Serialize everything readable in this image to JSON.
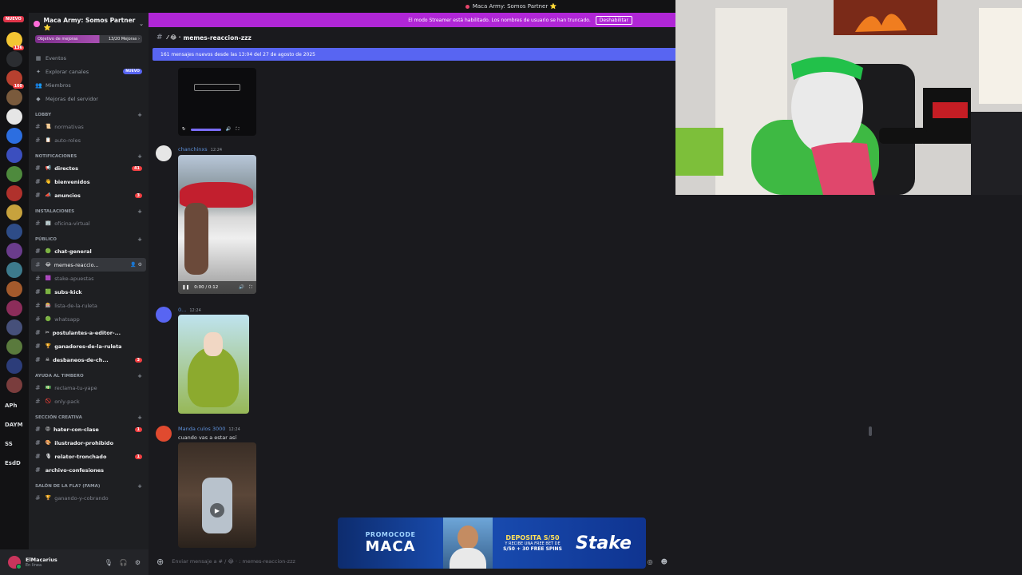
{
  "window": {
    "title": "Maca Army: Somos Partner ⭐"
  },
  "rail": {
    "new_label": "NUEVO",
    "servers": [
      {
        "color": "#f3c533",
        "badge": "136"
      },
      {
        "color": "#2b2d31",
        "badge": ""
      },
      {
        "color": "#b8402f",
        "badge": "160"
      },
      {
        "color": "#7a5a3c",
        "badge": ""
      },
      {
        "color": "#e6e6e6",
        "badge": ""
      },
      {
        "color": "#2c6ee0",
        "badge": ""
      },
      {
        "color": "#3b4fbf",
        "badge": ""
      },
      {
        "color": "#4e8a3d",
        "badge": ""
      },
      {
        "color": "#b0312c",
        "badge": ""
      },
      {
        "color": "#c7a23d",
        "badge": ""
      },
      {
        "color": "#2e4c87",
        "badge": ""
      },
      {
        "color": "#6a3c8c",
        "badge": ""
      },
      {
        "color": "#3d7a8c",
        "badge": ""
      },
      {
        "color": "#a35a2c",
        "badge": ""
      },
      {
        "color": "#8c2d5a",
        "badge": ""
      },
      {
        "color": "#46507a",
        "badge": ""
      },
      {
        "color": "#5a7a3d",
        "badge": ""
      },
      {
        "color": "#2c3d7a",
        "badge": ""
      },
      {
        "color": "#7a3d3d",
        "badge": ""
      }
    ],
    "labels": [
      "APh",
      "DAYM",
      "SS",
      "EsdD"
    ]
  },
  "sidebar": {
    "server_name": "Maca Army: Somos Partner ⭐",
    "boost_label": "Objetivo de mejoras",
    "boost_count": "13/20 Mejoras ›",
    "menu": [
      {
        "icon": "calendar-icon",
        "glyph": "▦",
        "label": "Eventos",
        "pill": ""
      },
      {
        "icon": "compass-icon",
        "glyph": "✦",
        "label": "Explorar canales",
        "pill": "NUEVO"
      },
      {
        "icon": "members-icon",
        "glyph": "👥",
        "label": "Miembros",
        "pill": ""
      },
      {
        "icon": "boost-icon",
        "glyph": "◆",
        "label": "Mejoras del servidor",
        "pill": ""
      }
    ],
    "categories": [
      {
        "name": "LOBBY",
        "channels": [
          {
            "emoji": "📜",
            "name": "normativas",
            "unread": false,
            "count": ""
          },
          {
            "emoji": "📋",
            "name": "auto-roles",
            "unread": false,
            "count": ""
          }
        ]
      },
      {
        "name": "NOTIFICACIONES",
        "channels": [
          {
            "emoji": "📢",
            "name": "directos",
            "unread": true,
            "count": "41"
          },
          {
            "emoji": "👋",
            "name": "bienvenidos",
            "unread": true,
            "count": ""
          },
          {
            "emoji": "📣",
            "name": "anuncios",
            "unread": true,
            "count": "3"
          }
        ]
      },
      {
        "name": "INSTALACIONES",
        "channels": [
          {
            "emoji": "🏢",
            "name": "oficina-virtual",
            "unread": false,
            "count": ""
          }
        ]
      },
      {
        "name": "PÚBLICO",
        "channels": [
          {
            "emoji": "🟢",
            "name": "chat-general",
            "unread": true,
            "count": ""
          },
          {
            "emoji": "😂",
            "name": "memes-reaccio...",
            "unread": false,
            "count": "",
            "active": true
          },
          {
            "emoji": "🟪",
            "name": "stake-apuestas",
            "unread": false,
            "count": ""
          },
          {
            "emoji": "🟩",
            "name": "subs-kick",
            "unread": true,
            "count": ""
          },
          {
            "emoji": "🎰",
            "name": "lista-de-la-ruleta",
            "unread": false,
            "count": ""
          },
          {
            "emoji": "🟢",
            "name": "whatsapp",
            "unread": false,
            "count": ""
          },
          {
            "emoji": "✂",
            "name": "postulantes-a-editor-...",
            "unread": true,
            "count": ""
          },
          {
            "emoji": "🏆",
            "name": "ganadores-de-la-ruleta",
            "unread": true,
            "count": ""
          },
          {
            "emoji": "☠",
            "name": "desbaneos-de-ch...",
            "unread": true,
            "count": "3"
          }
        ]
      },
      {
        "name": "AYUDA AL TIMBERO",
        "channels": [
          {
            "emoji": "💵",
            "name": "reclama-tu-yape",
            "unread": false,
            "count": ""
          },
          {
            "emoji": "🚫",
            "name": "only-pack",
            "unread": false,
            "count": ""
          }
        ]
      },
      {
        "name": "SECCIÓN CREATIVA",
        "channels": [
          {
            "emoji": "😡",
            "name": "hater-con-clase",
            "unread": true,
            "count": "1"
          },
          {
            "emoji": "🎨",
            "name": "ilustrador-prohibido",
            "unread": true,
            "count": ""
          },
          {
            "emoji": "🎙",
            "name": "relator-tronchado",
            "unread": true,
            "count": "1"
          },
          {
            "emoji": "",
            "name": "archivo-confesiones",
            "unread": true,
            "count": ""
          }
        ]
      },
      {
        "name": "SALÓN DE LA FLA? (FAMA)",
        "channels": [
          {
            "emoji": "🏆",
            "name": "ganando-y-cobrando",
            "unread": false,
            "count": ""
          }
        ]
      }
    ]
  },
  "user": {
    "name": "ElMacarius",
    "status": "En línea"
  },
  "main": {
    "streamer_notice": "El modo Streamer está habilitado. Los nombres de usuario se han truncado.",
    "streamer_button": "Deshabilitar",
    "channel_name": "memes-reaccion-zzz",
    "new_messages": "161 mensajes nuevos desde las 13:04 del 27 de agosto de 2025",
    "messages": [
      {
        "author": "chanchinxs",
        "time": "12:24",
        "text": "",
        "avatar_color": "#e6e6e6",
        "video_time": "0:00 / 0:12"
      },
      {
        "author": "0...",
        "time": "12:24",
        "text": "",
        "avatar_color": "#5865f2"
      },
      {
        "author": "Manda culos 3000",
        "time": "12:24",
        "text": "cuando vas a estar así",
        "avatar_color": "#e04a2f"
      }
    ],
    "composer_placeholder": "Enviar mensaje a # / 😂 · : memes-reaccion-zzz"
  },
  "promo": {
    "code_label": "PROMOCODE",
    "code": "MACA",
    "deposit": "DEPOSITA S/50",
    "deposit_sub": "Y RECIBE UNA FREE BET DE",
    "bonus": "S/50 + 30 FREE SPINS",
    "brand": "Stake"
  }
}
